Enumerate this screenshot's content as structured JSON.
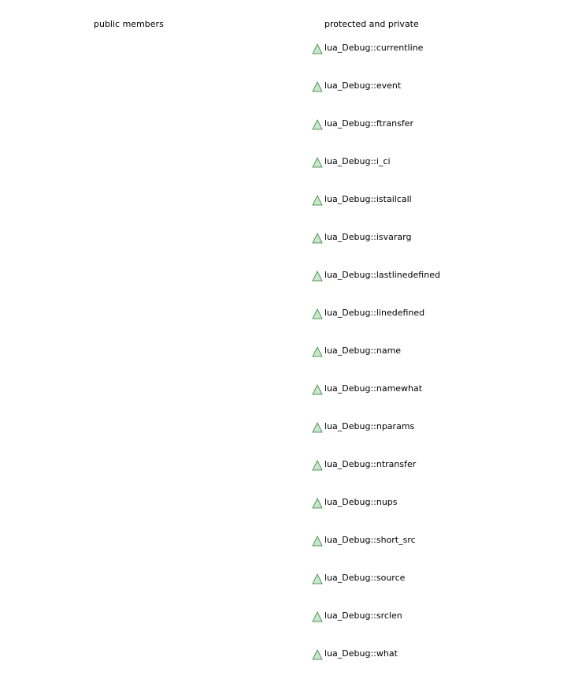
{
  "columns": {
    "public_header": "public members",
    "private_header": "protected and private"
  },
  "colors": {
    "icon_fill": "#c8e6c9",
    "icon_stroke": "#2e7d32",
    "text": "#000000"
  },
  "icon": "protected-member-triangle-icon",
  "members": [
    "lua_Debug::currentline",
    "lua_Debug::event",
    "lua_Debug::ftransfer",
    "lua_Debug::i_ci",
    "lua_Debug::istailcall",
    "lua_Debug::isvararg",
    "lua_Debug::lastlinedefined",
    "lua_Debug::linedefined",
    "lua_Debug::name",
    "lua_Debug::namewhat",
    "lua_Debug::nparams",
    "lua_Debug::ntransfer",
    "lua_Debug::nups",
    "lua_Debug::short_src",
    "lua_Debug::source",
    "lua_Debug::srclen",
    "lua_Debug::what"
  ]
}
